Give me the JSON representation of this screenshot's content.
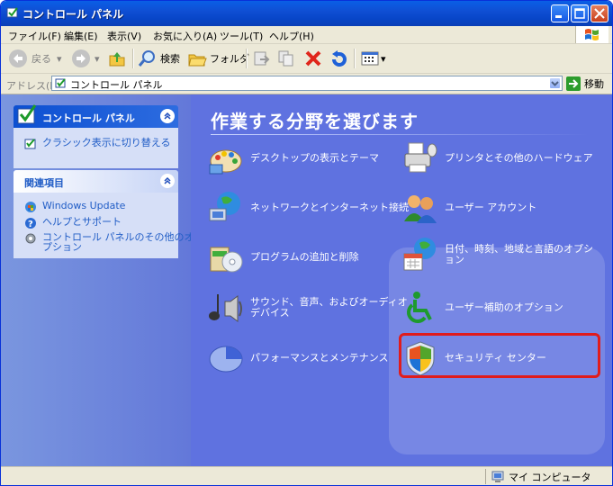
{
  "window": {
    "title": "コントロール パネル"
  },
  "menubar": {
    "items": [
      "ファイル(F)",
      "編集(E)",
      "表示(V)",
      "お気に入り(A)",
      "ツール(T)",
      "ヘルプ(H)"
    ]
  },
  "toolbar": {
    "back_label": "戻る",
    "search_label": "検索",
    "folders_label": "フォルダ"
  },
  "address": {
    "label": "アドレス(D)",
    "value": "コントロール パネル",
    "go_label": "移動"
  },
  "sidebar": {
    "panel1": {
      "title": "コントロール パネル",
      "link": "クラシック表示に切り替える"
    },
    "panel2": {
      "title": "関連項目",
      "links": [
        "Windows Update",
        "ヘルプとサポート",
        "コントロール パネルのその他のオ",
        "プション"
      ]
    }
  },
  "main": {
    "heading": "作業する分野を選びます",
    "categories": [
      {
        "label": "デスクトップの表示とテーマ",
        "icon": "desktop-theme-icon"
      },
      {
        "label": "プリンタとその他のハードウェア",
        "icon": "printer-icon"
      },
      {
        "label": "ネットワークとインターネット接続",
        "icon": "network-icon"
      },
      {
        "label": "ユーザー アカウント",
        "icon": "user-accounts-icon"
      },
      {
        "label": "プログラムの追加と削除",
        "icon": "add-remove-programs-icon"
      },
      {
        "label1": "日付、時刻、地域と言語のオプシ",
        "label2": "ョン",
        "icon": "date-time-icon"
      },
      {
        "label1": "サウンド、音声、およびオーディオ",
        "label2": "デバイス",
        "icon": "sound-icon"
      },
      {
        "label": "ユーザー補助のオプション",
        "icon": "accessibility-icon"
      },
      {
        "label": "パフォーマンスとメンテナンス",
        "icon": "performance-icon"
      },
      {
        "label": "セキュリティ センター",
        "icon": "security-center-icon"
      }
    ]
  },
  "statusbar": {
    "location": "マイ コンピュータ"
  },
  "colors": {
    "highlight": "#e01c1c",
    "link": "#215dc6",
    "main_bg": "#5f72e0"
  }
}
